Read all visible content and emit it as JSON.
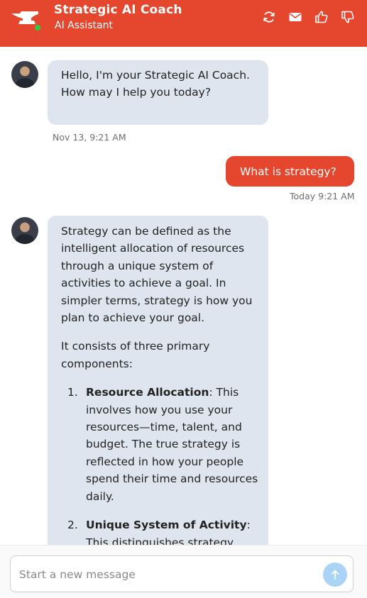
{
  "header": {
    "title": "Strategic AI Coach",
    "subtitle": "AI Assistant",
    "icons": [
      "refresh-icon",
      "mail-icon",
      "thumbs-up-icon",
      "thumbs-down-icon"
    ]
  },
  "messages": {
    "bot_greeting": {
      "text": "Hello, I'm your Strategic AI Coach. How may I help you today?",
      "timestamp": "Nov 13, 9:21 AM"
    },
    "user_question": {
      "text": "What is strategy?",
      "timestamp": "Today 9:21 AM"
    },
    "bot_answer": {
      "para1": "Strategy can be defined as the intelligent allocation of resources through a unique system of activities to achieve a goal. In simpler terms, strategy is how you plan to achieve your goal.",
      "para2": "It consists of three primary components:",
      "items": [
        {
          "num": "1.",
          "title": "Resource Allocation",
          "text": ": This involves how you use your resources—time, talent, and budget. The true strategy is reflected in how your people spend their time and resources daily."
        },
        {
          "num": "2.",
          "title": "Unique System of Activity",
          "text": ": This distinguishes strategy"
        }
      ]
    }
  },
  "composer": {
    "placeholder": "Start a new message"
  },
  "colors": {
    "brand": "#e5462e",
    "bot_bubble": "#dfe5ef",
    "send_button": "#a9d4f5",
    "online": "#2ecc40"
  }
}
